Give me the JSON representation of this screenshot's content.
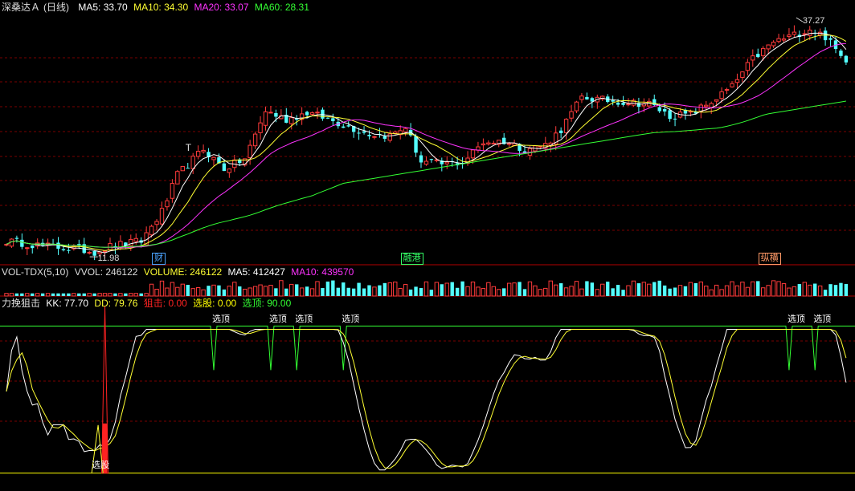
{
  "colors": {
    "bg": "#000000",
    "up": "#ff3b3b",
    "down": "#54ffff",
    "ma5": "#ffffff",
    "ma10": "#ffff33",
    "ma20": "#ff33ff",
    "ma60": "#33ff33",
    "grid": "#7a0000",
    "kk": "#ffffff",
    "dd": "#ffff33",
    "attack": "#ff2222",
    "pick": "#ffff00",
    "top": "#33ff33"
  },
  "main_legend": {
    "stock": "深桑达Ａ",
    "period": "(日线)",
    "ma5": "MA5: 33.70",
    "ma10": "MA10: 34.30",
    "ma20": "MA20: 33.07",
    "ma60": "MA60: 28.31"
  },
  "vol_legend": {
    "name": "VOL-TDX(5,10)",
    "vvol": "VVOL: 246122",
    "volume": "VOLUME: 246122",
    "ma5": "MA5: 412427",
    "ma10": "MA10: 439570"
  },
  "ind_legend": {
    "name": "力挽狙击",
    "kk": "KK: 77.70",
    "dd": "DD: 79.76",
    "attack": "狙击: 0.00",
    "pick": "选股: 0.00",
    "top": "选顶: 90.00"
  },
  "price_marks": {
    "low": "11.98",
    "high": "37.27",
    "t_mark": "T"
  },
  "event_tags": [
    {
      "label": "财",
      "index": 29,
      "color": "#4aa3ff"
    },
    {
      "label": "融港",
      "index": 77,
      "color": "#33ff66"
    },
    {
      "label": "纵横",
      "index": 146,
      "color": "#ff9966"
    }
  ],
  "signal_labels": {
    "pick": "选股",
    "top": "选顶"
  },
  "chart_data": {
    "type": "candlestick",
    "n_bars": 163,
    "price_anchors": [
      [
        0,
        13.2
      ],
      [
        8,
        12.6
      ],
      [
        14,
        12.3
      ],
      [
        17,
        11.98
      ],
      [
        20,
        12.6
      ],
      [
        26,
        13.2
      ],
      [
        30,
        16.5
      ],
      [
        33,
        20.6
      ],
      [
        38,
        23.5
      ],
      [
        42,
        21.3
      ],
      [
        46,
        22.4
      ],
      [
        50,
        27.8
      ],
      [
        54,
        26.8
      ],
      [
        58,
        27.6
      ],
      [
        62,
        26.9
      ],
      [
        66,
        26.0
      ],
      [
        70,
        25.2
      ],
      [
        74,
        25.0
      ],
      [
        77,
        26.0
      ],
      [
        80,
        22.1
      ],
      [
        84,
        21.8
      ],
      [
        88,
        22.0
      ],
      [
        92,
        24.3
      ],
      [
        96,
        24.4
      ],
      [
        100,
        23.5
      ],
      [
        104,
        24.0
      ],
      [
        107,
        25.7
      ],
      [
        111,
        29.3
      ],
      [
        115,
        29.0
      ],
      [
        119,
        28.8
      ],
      [
        124,
        28.6
      ],
      [
        128,
        27.2
      ],
      [
        132,
        27.4
      ],
      [
        136,
        28.8
      ],
      [
        140,
        30.5
      ],
      [
        144,
        33.6
      ],
      [
        148,
        35.5
      ],
      [
        152,
        36.3
      ],
      [
        155,
        37.0
      ],
      [
        158,
        36.1
      ],
      [
        161,
        33.9
      ],
      [
        162,
        33.6
      ]
    ],
    "y_range": [
      11.0,
      38.6
    ],
    "signals": {
      "attack_index": 19,
      "pick_index": 18,
      "top_indices": [
        40,
        51,
        56,
        65,
        151,
        156
      ]
    },
    "indicator_range": [
      -5,
      100
    ],
    "top_line_value": 90,
    "pick_line_value": 0
  }
}
